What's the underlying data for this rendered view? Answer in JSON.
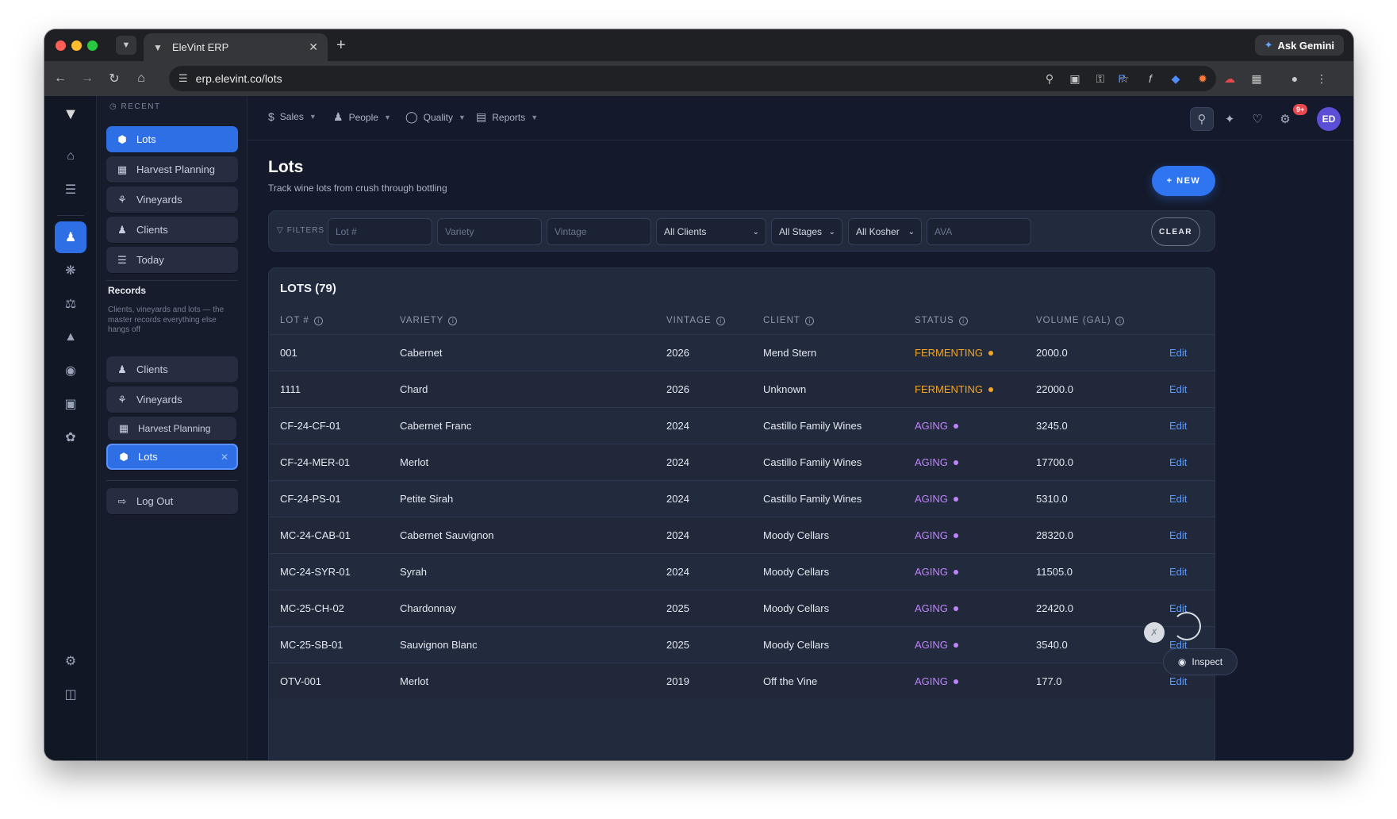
{
  "browser": {
    "tab_title": "EleVint ERP",
    "url": "erp.elevint.co/lots",
    "gemini_label": "Ask Gemini"
  },
  "sidebar": {
    "recent_label": "RECENT",
    "recent_items": [
      {
        "label": "Lots",
        "icon": "cube-icon",
        "active": true
      },
      {
        "label": "Harvest Planning",
        "icon": "calendar-icon"
      },
      {
        "label": "Vineyards",
        "icon": "sprout-icon"
      },
      {
        "label": "Clients",
        "icon": "users-icon"
      },
      {
        "label": "Today",
        "icon": "checklist-icon"
      }
    ],
    "records_title": "Records",
    "records_desc": "Clients, vineyards and lots — the master records everything else hangs off",
    "record_items": [
      {
        "label": "Clients",
        "icon": "users-icon"
      },
      {
        "label": "Vineyards",
        "icon": "sprout-icon"
      },
      {
        "label": "Harvest Planning",
        "icon": "calendar-icon"
      },
      {
        "label": "Lots",
        "icon": "cube-icon",
        "active": true
      }
    ],
    "logout_label": "Log Out"
  },
  "topnav": {
    "items": [
      {
        "label": "Sales",
        "icon": "dollar-icon"
      },
      {
        "label": "People",
        "icon": "people-icon"
      },
      {
        "label": "Quality",
        "icon": "shield-icon"
      },
      {
        "label": "Reports",
        "icon": "bar-chart-icon"
      }
    ],
    "notif_count": "9+",
    "avatar_initials": "ED"
  },
  "page": {
    "title": "Lots",
    "subtitle": "Track wine lots from crush through bottling",
    "new_button": "+ NEW"
  },
  "filters": {
    "label": "FILTERS",
    "lot_placeholder": "Lot #",
    "variety_placeholder": "Variety",
    "vintage_placeholder": "Vintage",
    "clients_select": "All Clients",
    "stages_select": "All Stages",
    "kosher_select": "All Kosher",
    "ava_placeholder": "AVA",
    "clear_button": "CLEAR"
  },
  "table": {
    "title": "LOTS (79)",
    "columns": [
      "LOT #",
      "VARIETY",
      "VINTAGE",
      "CLIENT",
      "STATUS",
      "VOLUME (GAL)"
    ],
    "edit_label": "Edit",
    "rows": [
      {
        "lot": "001",
        "variety": "Cabernet",
        "vintage": "2026",
        "client": "Mend Stern",
        "status": "FERMENTING",
        "volume": "2000.0"
      },
      {
        "lot": "1111",
        "variety": "Chard",
        "vintage": "2026",
        "client": "Unknown",
        "status": "FERMENTING",
        "volume": "22000.0"
      },
      {
        "lot": "CF-24-CF-01",
        "variety": "Cabernet Franc",
        "vintage": "2024",
        "client": "Castillo Family Wines",
        "status": "AGING",
        "volume": "3245.0"
      },
      {
        "lot": "CF-24-MER-01",
        "variety": "Merlot",
        "vintage": "2024",
        "client": "Castillo Family Wines",
        "status": "AGING",
        "volume": "17700.0"
      },
      {
        "lot": "CF-24-PS-01",
        "variety": "Petite Sirah",
        "vintage": "2024",
        "client": "Castillo Family Wines",
        "status": "AGING",
        "volume": "5310.0"
      },
      {
        "lot": "MC-24-CAB-01",
        "variety": "Cabernet Sauvignon",
        "vintage": "2024",
        "client": "Moody Cellars",
        "status": "AGING",
        "volume": "28320.0"
      },
      {
        "lot": "MC-24-SYR-01",
        "variety": "Syrah",
        "vintage": "2024",
        "client": "Moody Cellars",
        "status": "AGING",
        "volume": "11505.0"
      },
      {
        "lot": "MC-25-CH-02",
        "variety": "Chardonnay",
        "vintage": "2025",
        "client": "Moody Cellars",
        "status": "AGING",
        "volume": "22420.0"
      },
      {
        "lot": "MC-25-SB-01",
        "variety": "Sauvignon Blanc",
        "vintage": "2025",
        "client": "Moody Cellars",
        "status": "AGING",
        "volume": "3540.0"
      },
      {
        "lot": "OTV-001",
        "variety": "Merlot",
        "vintage": "2019",
        "client": "Off the Vine",
        "status": "AGING",
        "volume": "177.0"
      }
    ]
  },
  "colors": {
    "accent": "#2f6fe6",
    "fermenting": "#f5a524",
    "aging": "#c084fc",
    "edit_link": "#5b9bff"
  },
  "inspect_label": "Inspect"
}
